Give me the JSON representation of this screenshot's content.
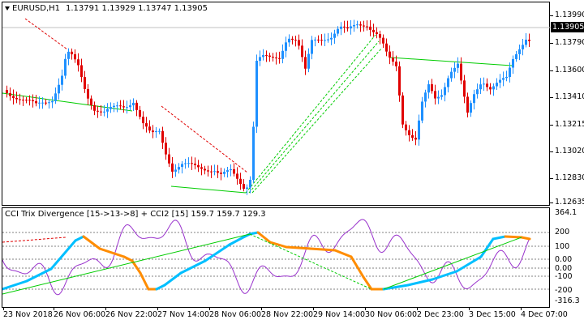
{
  "chart": {
    "symbol_label": "EURUSD,H1",
    "ohlc_label": "1.13791 1.13929 1.13747 1.13905",
    "current_price": "1.13905",
    "price_axis": [
      "1.13990",
      "1.13790",
      "1.13600",
      "1.13410",
      "1.13215",
      "1.13020",
      "1.12830",
      "1.12635"
    ],
    "indicator_title": "CCI Trix Divergence [15->13->8] + CCI2 [15] 159.7 159.7 129.3",
    "indicator_axis": [
      "364.1",
      "200",
      "100",
      "0.00",
      "0.00",
      "-100",
      "-200",
      "-316.3"
    ],
    "time_axis": [
      "23 Nov 2018",
      "26 Nov 06:00",
      "26 Nov 22:00",
      "27 Nov 14:00",
      "28 Nov 06:00",
      "28 Nov 22:00",
      "29 Nov 14:00",
      "30 Nov 06:00",
      "2 Dec 23:00",
      "3 Dec 15:00",
      "4 Dec 07:00"
    ],
    "colors": {
      "bull_candle": "#1e90ff",
      "bear_candle": "#e00000",
      "trendline_support": "#00cc00",
      "trendline_resistance": "#e00000",
      "cci_line": "#9932cc",
      "trix_up": "#00bfff",
      "trix_down": "#ff8c00",
      "grid_dotted": "#808080"
    }
  }
}
